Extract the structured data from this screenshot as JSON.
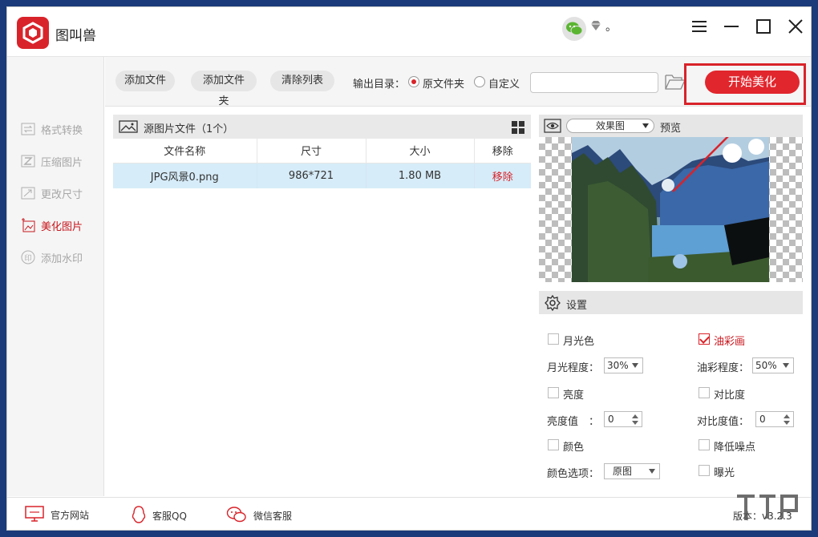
{
  "app": {
    "title": "图叫兽",
    "user_suffix": "。"
  },
  "sidebar": {
    "items": [
      {
        "label": "格式转换",
        "icon": "format-convert-icon"
      },
      {
        "label": "压缩图片",
        "icon": "compress-icon"
      },
      {
        "label": "更改尺寸",
        "icon": "resize-icon"
      },
      {
        "label": "美化图片",
        "icon": "beautify-icon",
        "active": true
      },
      {
        "label": "添加水印",
        "icon": "watermark-icon"
      }
    ]
  },
  "toolbar": {
    "add_file": "添加文件",
    "add_folder": "添加文件夹",
    "clear_list": "清除列表",
    "output_label": "输出目录：",
    "opt_original": "原文件夹",
    "opt_custom": "自定义",
    "path_value": "",
    "start": "开始美化"
  },
  "source": {
    "title": "源图片文件（1个）",
    "columns": [
      "文件名称",
      "尺寸",
      "大小",
      "移除"
    ],
    "rows": [
      {
        "name": "JPG风景0.png",
        "size": "986*721",
        "filesize": "1.80 MB",
        "remove": "移除"
      }
    ]
  },
  "preview": {
    "effect": "效果图",
    "label": "预览"
  },
  "settings": {
    "title": "设置",
    "moonlight": "月光色",
    "oil": "油彩画",
    "moon_level_label": "月光程度：",
    "moon_level": "30%",
    "oil_level_label": "油彩程度：",
    "oil_level": "50%",
    "brightness": "亮度",
    "contrast": "对比度",
    "brightness_val_label": "亮度值　：",
    "brightness_val": "0",
    "contrast_val_label": "对比度值：",
    "contrast_val": "0",
    "color": "颜色",
    "denoise": "降低噪点",
    "color_opt_label": "颜色选项：",
    "color_opt": "原图",
    "exposure": "曝光"
  },
  "footer": {
    "site": "官方网站",
    "qq": "客服QQ",
    "wechat": "微信客服",
    "version": "版本：v3.2.3"
  },
  "colors": {
    "accent": "#e1262d",
    "selected_row": "#d6ecf8"
  }
}
